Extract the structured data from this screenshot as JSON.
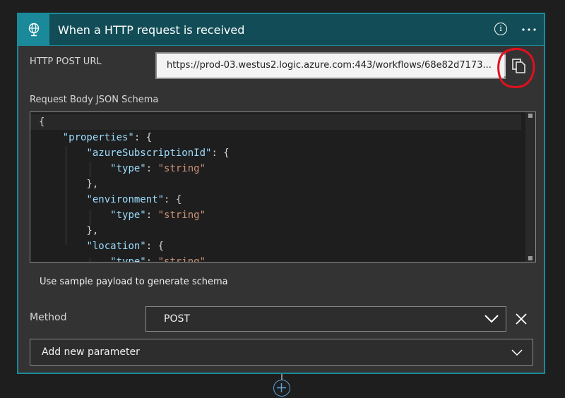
{
  "header": {
    "title": "When a HTTP request is received",
    "info_glyph": "i"
  },
  "url_field": {
    "label": "HTTP POST URL",
    "value": "https://prod-03.westus2.logic.azure.com:443/workflows/68e82d7173..."
  },
  "schema": {
    "label": "Request Body JSON Schema",
    "lines": [
      [
        "{"
      ],
      [
        "    ",
        "\"properties\"",
        ": {"
      ],
      [
        "        ",
        "\"azureSubscriptionId\"",
        ": {"
      ],
      [
        "            ",
        "\"type\"",
        ": ",
        "\"string\""
      ],
      [
        "        },"
      ],
      [
        "        ",
        "\"environment\"",
        ": {"
      ],
      [
        "            ",
        "\"type\"",
        ": ",
        "\"string\""
      ],
      [
        "        },"
      ],
      [
        "        ",
        "\"location\"",
        ": {"
      ],
      [
        "            ",
        "\"type\"",
        ": ",
        "\"string\""
      ]
    ]
  },
  "sample_link": "Use sample payload to generate schema",
  "method": {
    "label": "Method",
    "value": "POST"
  },
  "add_parameter": "Add new parameter",
  "colors": {
    "accent": "#1a8a9a",
    "header_bg": "#124d57",
    "annotation": "#e0101f",
    "json_key": "#9cdcfe",
    "json_string": "#ce9178"
  },
  "icons": {
    "trigger": "globe-request-icon",
    "info": "info-icon",
    "more": "more-options-icon",
    "copy": "copy-icon",
    "method_dropdown": "chevron-down-icon",
    "clear": "close-icon",
    "param_dropdown": "chevron-down-icon",
    "add_step": "plus-icon"
  }
}
